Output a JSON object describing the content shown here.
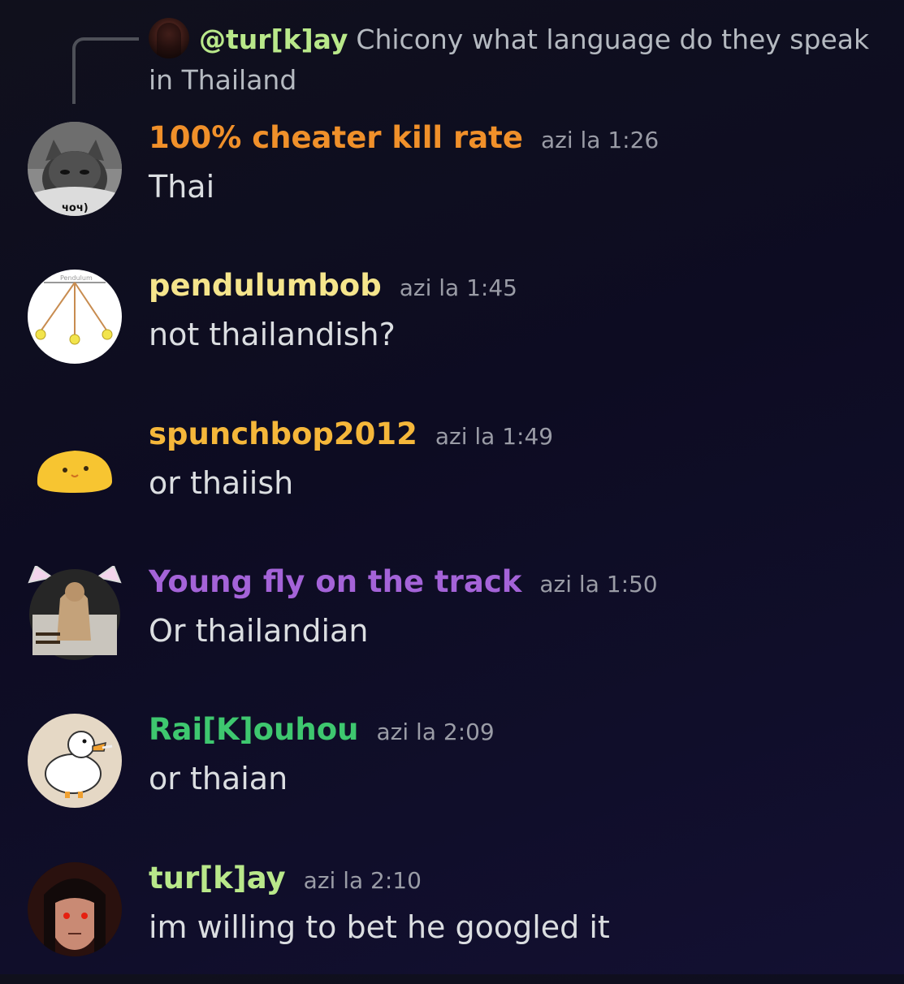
{
  "reply": {
    "author": "@tur[k]ay",
    "text": "Chicony what language do they speak in Thailand"
  },
  "colors": {
    "background": "#0e0d24",
    "reply_author": "#b9e88a",
    "timestamp": "#9a9ca6",
    "message_text": "#dbdee1"
  },
  "messages": [
    {
      "username": "100% cheater kill rate",
      "username_color": "#f0902a",
      "timestamp": "azi la 1:26",
      "text": "Thai",
      "avatar": "gray-cat-avatar",
      "avatar_caption": "чоч)"
    },
    {
      "username": "pendulumbob",
      "username_color": "#f5e58c",
      "timestamp": "azi la 1:45",
      "text": "not thailandish?",
      "avatar": "pendulum-avatar",
      "avatar_caption": "Pendulum"
    },
    {
      "username": "spunchbop2012",
      "username_color": "#f5b73a",
      "timestamp": "azi la 1:49",
      "text": "or thaiish",
      "avatar": "yellow-blob-avatar"
    },
    {
      "username": "Young fly on the track",
      "username_color": "#a463d8",
      "timestamp": "azi la 1:50",
      "text": "Or thailandian",
      "avatar": "cougar-cat-ears-avatar"
    },
    {
      "username": "Rai[K]ouhou",
      "username_color": "#3ec76f",
      "timestamp": "azi la 2:09",
      "text": "or thaian",
      "avatar": "duck-avatar"
    },
    {
      "username": "tur[k]ay",
      "username_color": "#b9e88a",
      "timestamp": "azi la 2:10",
      "text": "im willing to bet he googled it",
      "avatar": "dark-hair-red-eyes-avatar"
    }
  ]
}
